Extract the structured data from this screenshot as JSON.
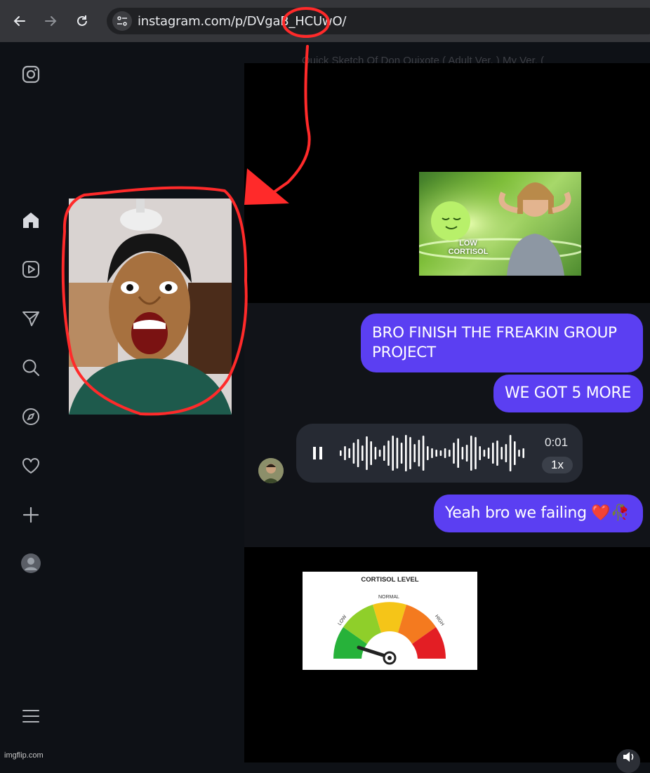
{
  "browser": {
    "url": "instagram.com/p/DVgaB_HCUwO/"
  },
  "background_caption": "Quick Sketch Of Don Quixote ( Adult Ver. ) My Ver. (",
  "sidebar": {
    "items": [
      {
        "icon": "instagram-logo-icon"
      },
      {
        "icon": "home-icon"
      },
      {
        "icon": "reels-icon"
      },
      {
        "icon": "messages-icon"
      },
      {
        "icon": "search-icon"
      },
      {
        "icon": "explore-icon"
      },
      {
        "icon": "notifications-icon"
      },
      {
        "icon": "create-icon"
      },
      {
        "icon": "profile-avatar"
      },
      {
        "icon": "menu-icon"
      }
    ]
  },
  "meme_image": {
    "text_line1": "LOW",
    "text_line2": "CORTISOL"
  },
  "messages": [
    {
      "text": "BRO FINISH THE FREAKIN GROUP PROJECT"
    },
    {
      "text": "WE GOT 5 MORE"
    },
    {
      "text": "Yeah bro we failing ❤️🥀"
    }
  ],
  "voice_message": {
    "duration": "0:01",
    "speed": "1x"
  },
  "gauge_image": {
    "title": "CORTISOL LEVEL",
    "labels": [
      "LOW",
      "NORMAL",
      "HIGH"
    ]
  },
  "watermark": "imgflip.com",
  "colors": {
    "bubble": "#5b3ff2",
    "annotation": "#ff2a2a",
    "browser_bar": "#35363a"
  }
}
